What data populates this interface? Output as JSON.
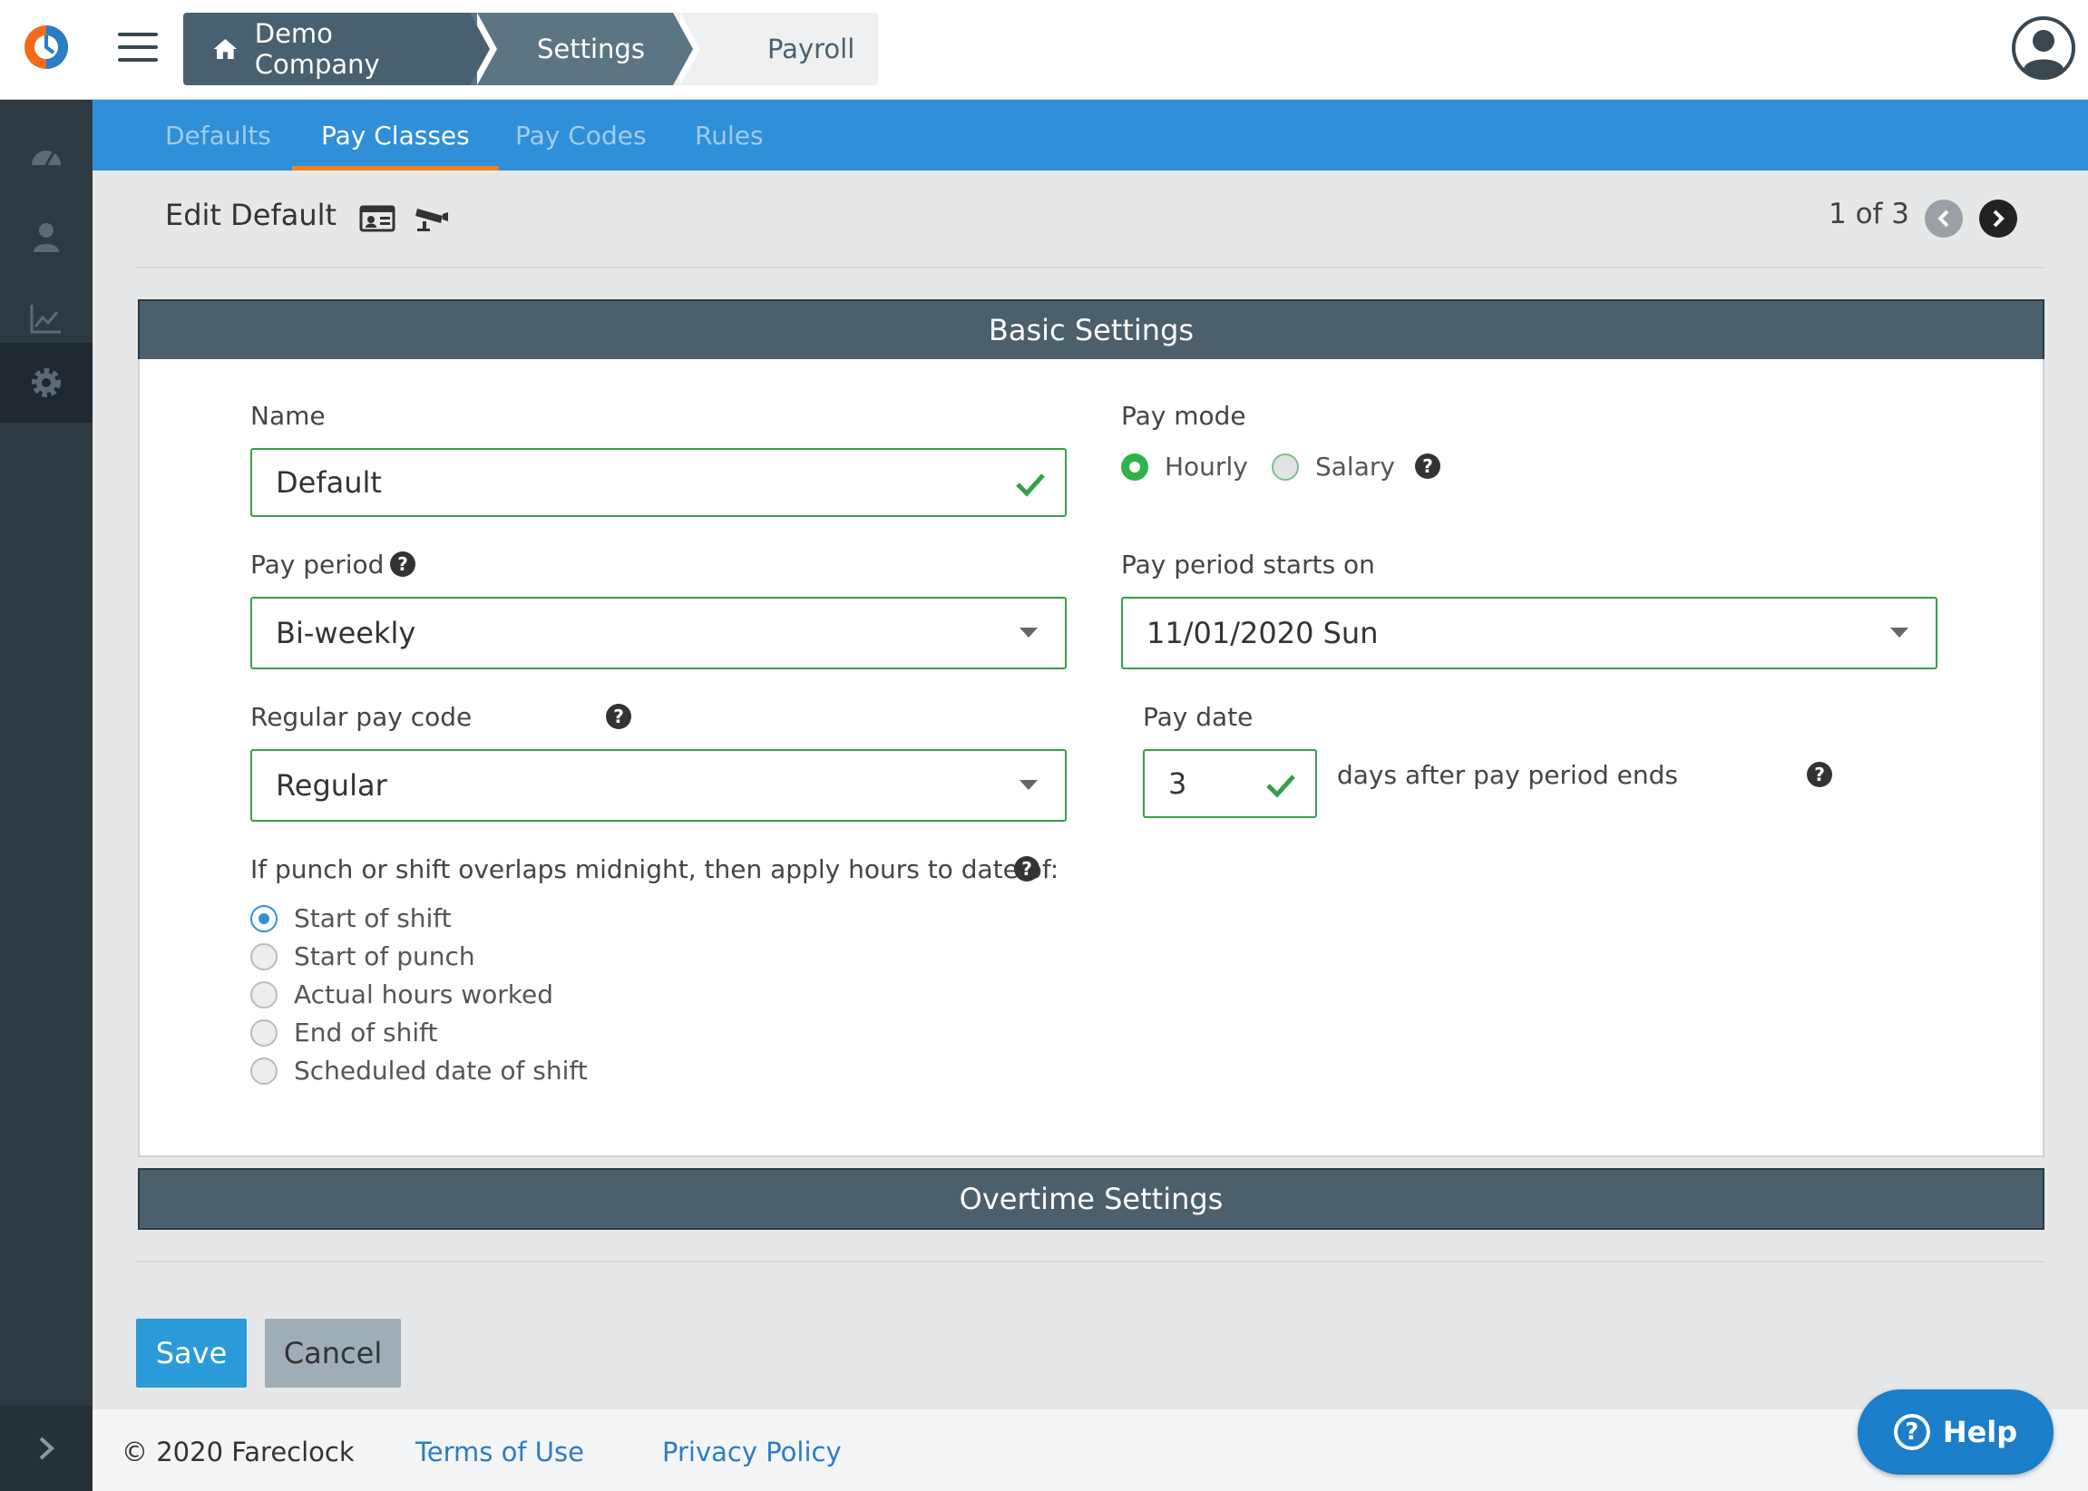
{
  "breadcrumb": {
    "company": "Demo Company",
    "settings": "Settings",
    "payroll": "Payroll"
  },
  "tabs": [
    {
      "label": "Defaults",
      "active": false
    },
    {
      "label": "Pay Classes",
      "active": true
    },
    {
      "label": "Pay Codes",
      "active": false
    },
    {
      "label": "Rules",
      "active": false
    }
  ],
  "header": {
    "title": "Edit Default",
    "pager": "1 of 3"
  },
  "basic_settings": {
    "title": "Basic Settings",
    "name_label": "Name",
    "name_value": "Default",
    "pay_mode_label": "Pay mode",
    "pay_mode_options": [
      "Hourly",
      "Salary"
    ],
    "pay_mode_selected": "Hourly",
    "pay_period_label": "Pay period",
    "pay_period_value": "Bi-weekly",
    "pay_period_starts_label": "Pay period starts on",
    "pay_period_starts_value": "11/01/2020 Sun",
    "regular_pay_code_label": "Regular pay code",
    "regular_pay_code_value": "Regular",
    "pay_date_label": "Pay date",
    "pay_date_value": "3",
    "pay_date_suffix": "days after pay period ends",
    "midnight_label": "If punch or shift overlaps midnight, then apply hours to date of:",
    "midnight_options": [
      "Start of shift",
      "Start of punch",
      "Actual hours worked",
      "End of shift",
      "Scheduled date of shift"
    ],
    "midnight_selected": "Start of shift"
  },
  "overtime_settings": {
    "title": "Overtime Settings"
  },
  "actions": {
    "save": "Save",
    "cancel": "Cancel"
  },
  "footer": {
    "copyright": "© 2020 Fareclock",
    "terms": "Terms of Use",
    "privacy": "Privacy Policy"
  },
  "help": {
    "label": "Help"
  },
  "colors": {
    "accent_blue": "#2f8fd8",
    "valid_green": "#35a04a",
    "tab_underline": "#f0821e",
    "panel_header": "#4b5f6d",
    "sidebar": "#2e3a42"
  }
}
